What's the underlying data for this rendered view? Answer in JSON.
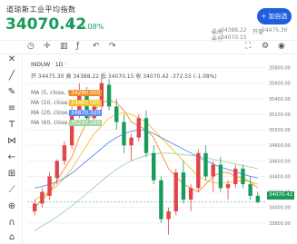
{
  "header": {
    "title": "道琼斯工业平均指数",
    "price": "34070.42",
    "arrow": "⬇",
    "change": "-1.08%",
    "stats": [
      {
        "label": "最高",
        "value": "34388.22"
      },
      {
        "label": "开盘",
        "value": "34475.30"
      },
      {
        "label": "最低",
        "value": "34070.15"
      }
    ],
    "add_button": "+ 加自选"
  },
  "toolbar": {
    "icons": [
      "clock-icon",
      "crosshair-icon",
      "bars-icon",
      "indicator-icon",
      "undo-icon",
      "redo-icon",
      "fullscreen-icon",
      "settings-icon",
      "camera-icon"
    ]
  },
  "chart": {
    "symbol": "INDUW · 1D ·",
    "ohlc": "开 34475.30 高 34388.22 低 34070.15 收 34070.42  -372.55 (-1.08%)",
    "ma": [
      {
        "label": "MA (5, close, 0)",
        "value": "34290.000",
        "color": "#f28c28"
      },
      {
        "label": "MA (10, close, 0)",
        "value": "34483.000",
        "color": "#f2c028"
      },
      {
        "label": "MA (20, close, 0)",
        "value": "34870.320",
        "color": "#5b8def"
      },
      {
        "label": "MA (60, close, 0)",
        "value": "35210.160",
        "color": "#9fd4a3"
      }
    ],
    "price_tag": "34070.42"
  },
  "chart_data": {
    "type": "candlestick",
    "title": "",
    "ylim": [
      33600,
      35900
    ],
    "y_ticks": [
      "35800.00",
      "35600.00",
      "35400.00",
      "35200.00",
      "35000.00",
      "34800.00",
      "34600.00",
      "34400.00",
      "34200.00",
      "34000.00",
      "33800.00"
    ],
    "candles": [
      {
        "o": 33950,
        "h": 34100,
        "l": 33900,
        "c": 34050
      },
      {
        "o": 34050,
        "h": 34250,
        "l": 34000,
        "c": 34200
      },
      {
        "o": 34150,
        "h": 34450,
        "l": 34100,
        "c": 34400
      },
      {
        "o": 34380,
        "h": 34620,
        "l": 34300,
        "c": 34600
      },
      {
        "o": 34600,
        "h": 34850,
        "l": 34550,
        "c": 34800
      },
      {
        "o": 34800,
        "h": 35300,
        "l": 34750,
        "c": 35250
      },
      {
        "o": 35250,
        "h": 35600,
        "l": 35150,
        "c": 35500
      },
      {
        "o": 35480,
        "h": 35550,
        "l": 35100,
        "c": 35150
      },
      {
        "o": 35150,
        "h": 35350,
        "l": 35050,
        "c": 35300
      },
      {
        "o": 35300,
        "h": 35700,
        "l": 35250,
        "c": 35600
      },
      {
        "o": 35580,
        "h": 35650,
        "l": 35250,
        "c": 35300
      },
      {
        "o": 35300,
        "h": 35400,
        "l": 35000,
        "c": 35100
      },
      {
        "o": 35100,
        "h": 35200,
        "l": 34700,
        "c": 34800
      },
      {
        "o": 34800,
        "h": 34950,
        "l": 34600,
        "c": 34900
      },
      {
        "o": 34900,
        "h": 35200,
        "l": 34850,
        "c": 35150
      },
      {
        "o": 35150,
        "h": 35250,
        "l": 34650,
        "c": 34700
      },
      {
        "o": 34700,
        "h": 34800,
        "l": 34300,
        "c": 34350
      },
      {
        "o": 34350,
        "h": 34400,
        "l": 33800,
        "c": 33850
      },
      {
        "o": 33850,
        "h": 34000,
        "l": 33650,
        "c": 33950
      },
      {
        "o": 33950,
        "h": 34500,
        "l": 33900,
        "c": 34450
      },
      {
        "o": 34450,
        "h": 34600,
        "l": 34050,
        "c": 34100
      },
      {
        "o": 34100,
        "h": 34300,
        "l": 33950,
        "c": 34250
      },
      {
        "o": 34250,
        "h": 34750,
        "l": 34200,
        "c": 34700
      },
      {
        "o": 34700,
        "h": 34800,
        "l": 34350,
        "c": 34400
      },
      {
        "o": 34400,
        "h": 34600,
        "l": 34200,
        "c": 34550
      },
      {
        "o": 34550,
        "h": 34650,
        "l": 34200,
        "c": 34250
      },
      {
        "o": 34250,
        "h": 34350,
        "l": 34100,
        "c": 34300
      },
      {
        "o": 34300,
        "h": 34550,
        "l": 34250,
        "c": 34500
      },
      {
        "o": 34500,
        "h": 34550,
        "l": 34250,
        "c": 34300
      },
      {
        "o": 34300,
        "h": 34400,
        "l": 34100,
        "c": 34150
      },
      {
        "o": 34150,
        "h": 34200,
        "l": 34050,
        "c": 34070
      }
    ],
    "ma_lines": [
      {
        "name": "MA5",
        "color": "#f28c28",
        "values": [
          34000,
          34100,
          34200,
          34350,
          34500,
          34650,
          34900,
          35100,
          35250,
          35350,
          35380,
          35350,
          35250,
          35100,
          35050,
          35000,
          34900,
          34700,
          34500,
          34400,
          34300,
          34250,
          34200,
          34300,
          34400,
          34450,
          34450,
          34400,
          34380,
          34330,
          34250
        ]
      },
      {
        "name": "MA10",
        "color": "#f2c028",
        "values": [
          34100,
          34150,
          34200,
          34280,
          34380,
          34500,
          34650,
          34800,
          34950,
          35050,
          35150,
          35200,
          35220,
          35200,
          35150,
          35100,
          35000,
          34900,
          34800,
          34700,
          34600,
          34500,
          34400,
          34350,
          34320,
          34310,
          34320,
          34340,
          34350,
          34330,
          34300
        ]
      },
      {
        "name": "MA20",
        "color": "#5b8def",
        "values": [
          34250,
          34270,
          34300,
          34330,
          34380,
          34440,
          34520,
          34600,
          34680,
          34760,
          34840,
          34900,
          34950,
          34980,
          35000,
          34990,
          34950,
          34900,
          34850,
          34800,
          34750,
          34700,
          34650,
          34600,
          34560,
          34520,
          34490,
          34460,
          34430,
          34400,
          34380
        ]
      },
      {
        "name": "MA60",
        "color": "#9fd4a3",
        "values": [
          33700,
          33760,
          33820,
          33880,
          33950,
          34020,
          34100,
          34180,
          34260,
          34340,
          34420,
          34490,
          34550,
          34600,
          34640,
          34670,
          34690,
          34700,
          34700,
          34690,
          34680,
          34670,
          34660,
          34640,
          34620,
          34600,
          34580,
          34560,
          34540,
          34520,
          34500
        ]
      }
    ]
  }
}
